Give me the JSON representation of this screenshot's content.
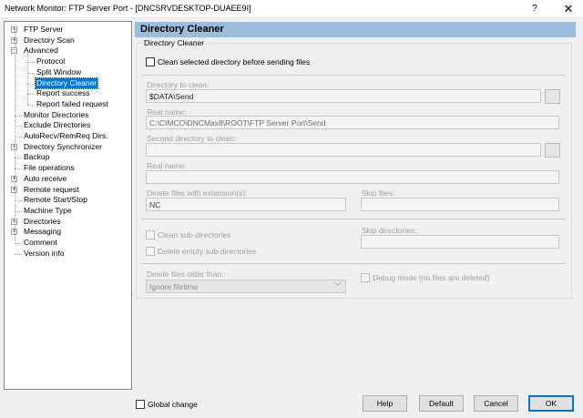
{
  "window": {
    "title": "Network Monitor: FTP Server Port - [DNCSRVDESKTOP-DUAEE9I]",
    "help_glyph": "?",
    "close_glyph": "✕"
  },
  "tree": {
    "items": [
      {
        "label": "FTP Server",
        "expander": "+"
      },
      {
        "label": "Directory Scan",
        "expander": "+"
      },
      {
        "label": "Advanced",
        "expander": "−"
      },
      {
        "label": "Protocol"
      },
      {
        "label": "Split Window"
      },
      {
        "label": "Directory Cleaner",
        "selected": true
      },
      {
        "label": "Report success"
      },
      {
        "label": "Report failed request"
      },
      {
        "label": "Monitor Directories"
      },
      {
        "label": "Exclude Directories"
      },
      {
        "label": "AutoRecv/RemReq Dirs."
      },
      {
        "label": "Directory Synchronizer",
        "expander": "+"
      },
      {
        "label": "Backup"
      },
      {
        "label": "File operations"
      },
      {
        "label": "Auto receive",
        "expander": "+"
      },
      {
        "label": "Remote request",
        "expander": "+"
      },
      {
        "label": "Remote Start/Stop"
      },
      {
        "label": "Machine Type"
      },
      {
        "label": "Directories",
        "expander": "+"
      },
      {
        "label": "Messaging",
        "expander": "+"
      },
      {
        "label": "Comment"
      },
      {
        "label": "Version info"
      }
    ]
  },
  "panel": {
    "header": "Directory Cleaner",
    "group_title": "Directory Cleaner",
    "clean_before_sending_label": "Clean selected directory before sending files",
    "clean_before_sending_checked": false,
    "dir_to_clean_label": "Directory to clean:",
    "dir_to_clean_value": "$DATA\\Send",
    "real_name_label": "Real name:",
    "real_name_value": "C:\\CIMCO\\DNCMax8\\ROOT\\FTP Server Port\\Send",
    "second_dir_label": "Second directory to clean:",
    "second_dir_value": "",
    "second_real_name_label": "Real name:",
    "second_real_name_value": "",
    "delete_ext_label": "Delete files with extension(s):",
    "delete_ext_value": "NC",
    "skip_files_label": "Skip files:",
    "skip_files_value": "",
    "clean_subdirs_label": "Clean sub-directories",
    "delete_empty_subdirs_label": "Delete empty sub-directories",
    "skip_dirs_label": "Skip directories:",
    "skip_dirs_value": "",
    "delete_older_label": "Delete files older than:",
    "delete_older_value": "Ignore filetime",
    "debug_mode_label": "Debug mode (no files are deleted)"
  },
  "footer": {
    "global_change_label": "Global change",
    "help_button": "Help",
    "default_button": "Default",
    "cancel_button": "Cancel",
    "ok_button": "OK"
  }
}
